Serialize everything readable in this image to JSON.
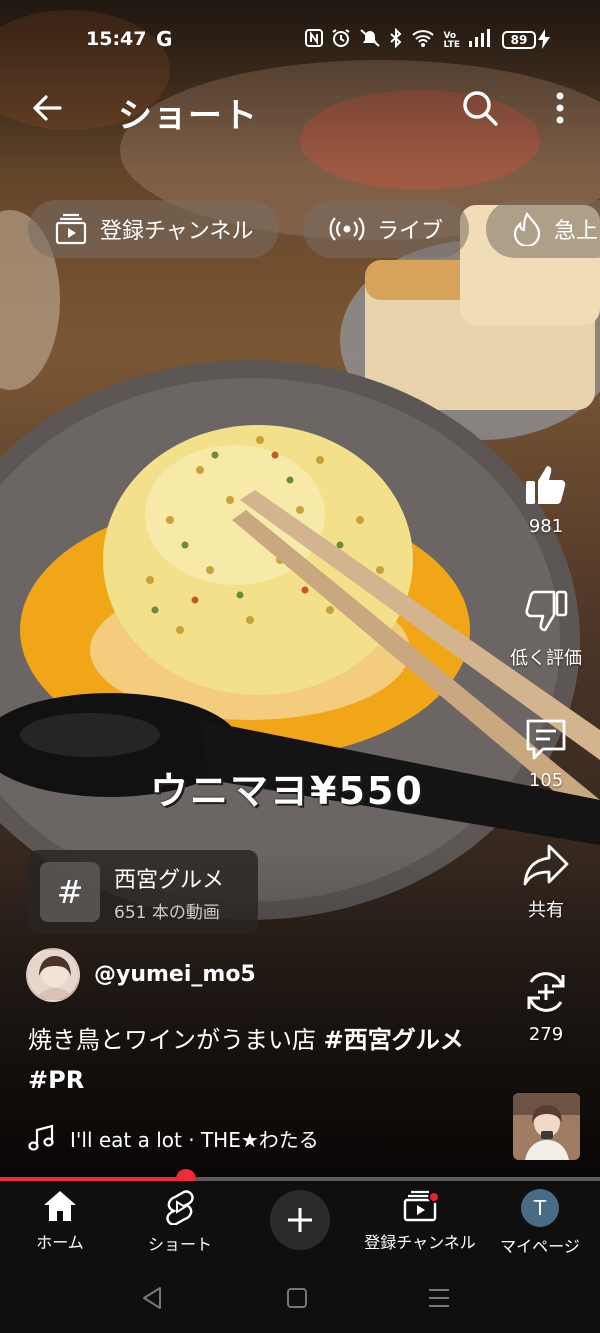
{
  "status_bar": {
    "time": "15:47",
    "google_indicator": "G",
    "battery": "89",
    "icons": [
      "nfc-icon",
      "alarm-icon",
      "mute-icon",
      "bluetooth-icon",
      "wifi-icon",
      "volte-icon",
      "signal-icon",
      "battery-icon",
      "charging-icon"
    ]
  },
  "app_bar": {
    "title": "ショート",
    "back_icon": "arrow-left-icon",
    "search_icon": "search-icon",
    "more_icon": "more-vertical-icon"
  },
  "chips": [
    {
      "label": "登録チャンネル",
      "icon": "subscriptions-icon"
    },
    {
      "label": "ライブ",
      "icon": "live-icon"
    },
    {
      "label": "急上",
      "icon": "trending-icon"
    }
  ],
  "video": {
    "overlay_caption": "ウニマヨ¥550"
  },
  "actions": {
    "like": {
      "label": "981",
      "icon": "thumbs-up-icon"
    },
    "dislike": {
      "label": "低く評価",
      "icon": "thumbs-down-icon"
    },
    "comments": {
      "label": "105",
      "icon": "comment-icon"
    },
    "share": {
      "label": "共有",
      "icon": "share-icon"
    },
    "remix": {
      "label": "279",
      "icon": "remix-icon"
    }
  },
  "hashtag_card": {
    "title": "西宮グルメ",
    "subtitle": "651 本の動画",
    "icon": "hashtag-icon"
  },
  "channel": {
    "handle": "@yumei_mo5"
  },
  "description": {
    "text": "焼き鳥とワインがうまい店 ",
    "tag1": "#西宮グルメ",
    "tag2": "#PR"
  },
  "music": {
    "label": "I'll eat a lot · THE★わたる",
    "icon": "music-note-icon"
  },
  "progress": {
    "fraction": 0.31,
    "color": "#f2293a"
  },
  "bottom_nav": {
    "home": "ホーム",
    "shorts": "ショート",
    "create_icon": "plus-icon",
    "subscriptions": "登録チャンネル",
    "profile": "マイページ",
    "profile_initial": "T"
  },
  "system_nav": [
    "back-triangle-icon",
    "home-square-icon",
    "recents-lines-icon"
  ]
}
